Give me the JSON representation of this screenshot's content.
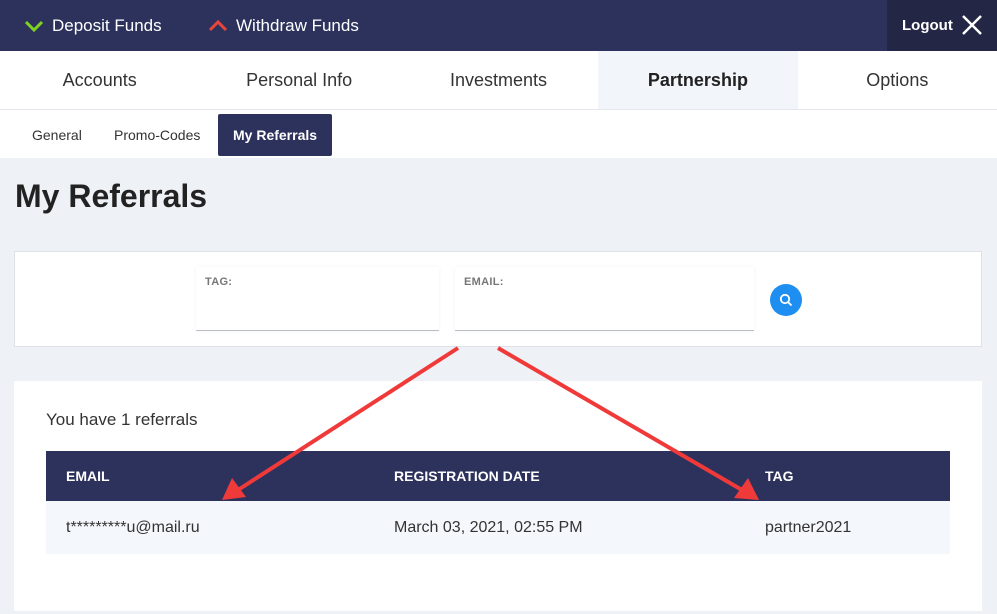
{
  "topbar": {
    "deposit_label": "Deposit Funds",
    "withdraw_label": "Withdraw Funds",
    "logout_label": "Logout",
    "deposit_icon": "chevron-down-icon",
    "withdraw_icon": "chevron-up-icon",
    "close_icon": "close-icon"
  },
  "main_tabs": [
    {
      "label": "Accounts",
      "active": false
    },
    {
      "label": "Personal Info",
      "active": false
    },
    {
      "label": "Investments",
      "active": false
    },
    {
      "label": "Partnership",
      "active": true
    },
    {
      "label": "Options",
      "active": false
    }
  ],
  "sub_tabs": [
    {
      "label": "General",
      "active": false
    },
    {
      "label": "Promo-Codes",
      "active": false
    },
    {
      "label": "My Referrals",
      "active": true
    }
  ],
  "page_title": "My Referrals",
  "filters": {
    "tag_label": "TAG:",
    "tag_value": "",
    "email_label": "EMAIL:",
    "email_value": "",
    "search_icon": "search-icon"
  },
  "results": {
    "count_text": "You have 1 referrals",
    "columns": [
      "EMAIL",
      "REGISTRATION DATE",
      "TAG"
    ],
    "rows": [
      {
        "email": "t*********u@mail.ru",
        "registration_date": "March 03, 2021, 02:55 PM",
        "tag": "partner2021"
      }
    ]
  },
  "colors": {
    "navy": "#2d325d",
    "accent_blue": "#1e8ef1",
    "deposit_green": "#7ed321",
    "withdraw_red": "#e8453c",
    "annotation_arrow": "#f03a3a"
  }
}
